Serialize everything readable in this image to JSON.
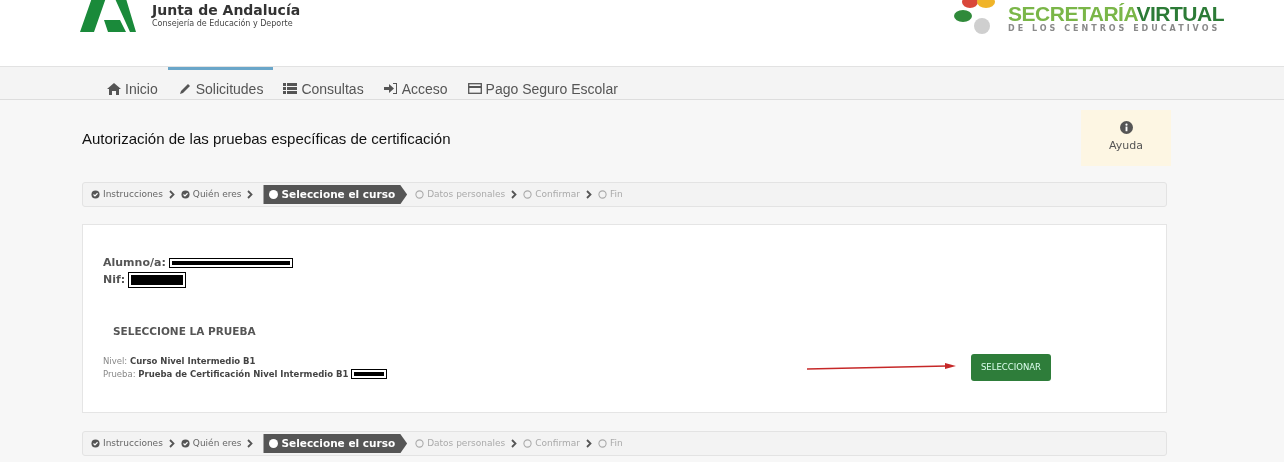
{
  "header": {
    "org_name": "Junta de Andalucía",
    "org_sub": "Consejería de Educación y Deporte",
    "brand_a": "SECRETARÍA",
    "brand_b": "VIRTUAL",
    "brand_sub": "DE LOS CENTROS EDUCATIVOS"
  },
  "nav": [
    {
      "label": "Inicio",
      "selected": false
    },
    {
      "label": "Solicitudes",
      "selected": true
    },
    {
      "label": "Consultas",
      "selected": false
    },
    {
      "label": "Acceso",
      "selected": false
    },
    {
      "label": "Pago Seguro Escolar",
      "selected": false
    }
  ],
  "page_title": "Autorización de las pruebas específicas de certificación",
  "help": {
    "label": "Ayuda"
  },
  "steps_top": [
    {
      "label": "Instrucciones",
      "kind": "done"
    },
    {
      "label": "Quién eres",
      "kind": "done"
    },
    {
      "label": "Seleccione el curso",
      "kind": "current"
    },
    {
      "label": "Datos personales",
      "kind": "pending"
    },
    {
      "label": "Confirmar",
      "kind": "pending"
    },
    {
      "label": "Fin",
      "kind": "pending"
    }
  ],
  "student": {
    "name_label": "Alumno/a:",
    "nif_label": "Nif:"
  },
  "section_title": "SELECCIONE LA PRUEBA",
  "course": {
    "nivel_label": "Nivel:",
    "nivel": "Curso Nivel Intermedio B1",
    "prueba_label": "Prueba:",
    "prueba": "Prueba de Certificación Nivel Intermedio B1",
    "button": "SELECCIONAR"
  },
  "steps_bottom": [
    {
      "label": "Instrucciones",
      "kind": "done"
    },
    {
      "label": "Quién eres",
      "kind": "done"
    },
    {
      "label": "Seleccione el curso",
      "kind": "current"
    },
    {
      "label": "Datos personales",
      "kind": "pending"
    },
    {
      "label": "Confirmar",
      "kind": "pending"
    },
    {
      "label": "Fin",
      "kind": "pending"
    }
  ]
}
